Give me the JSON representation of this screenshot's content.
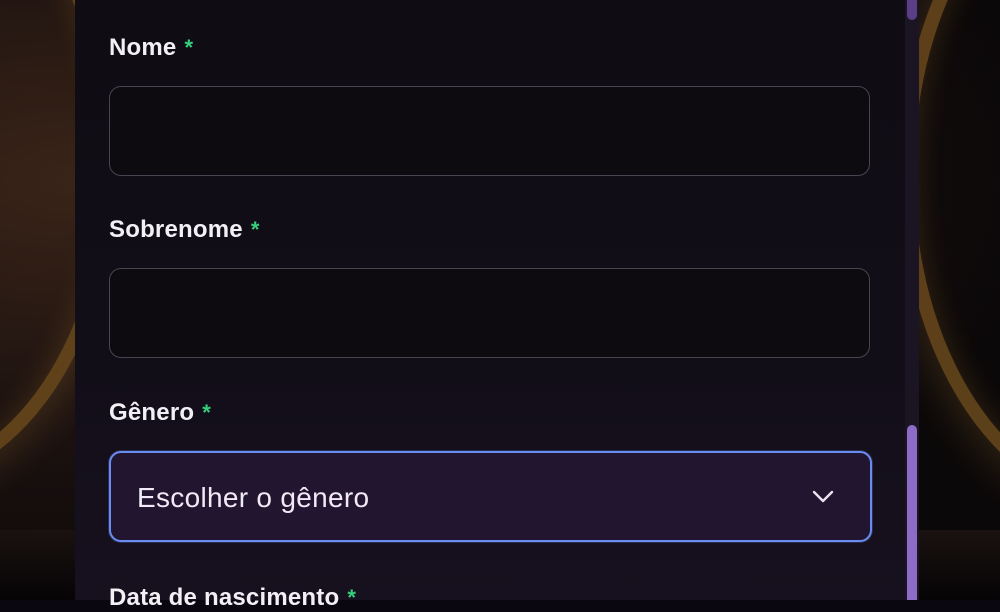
{
  "form": {
    "first_name": {
      "label": "Nome",
      "required_mark": "*",
      "value": ""
    },
    "last_name": {
      "label": "Sobrenome",
      "required_mark": "*",
      "value": ""
    },
    "gender": {
      "label": "Gênero",
      "required_mark": "*",
      "selected": "Escolher o gênero",
      "icon": "chevron-down-icon"
    },
    "birth_date": {
      "label": "Data de nascimento",
      "required_mark": "*"
    }
  },
  "colors": {
    "required": "#35d07c",
    "focus_border": "#6a8cf0",
    "scrollbar_thumb": "#8d6cc8",
    "panel_bg": "#0f0c13"
  }
}
